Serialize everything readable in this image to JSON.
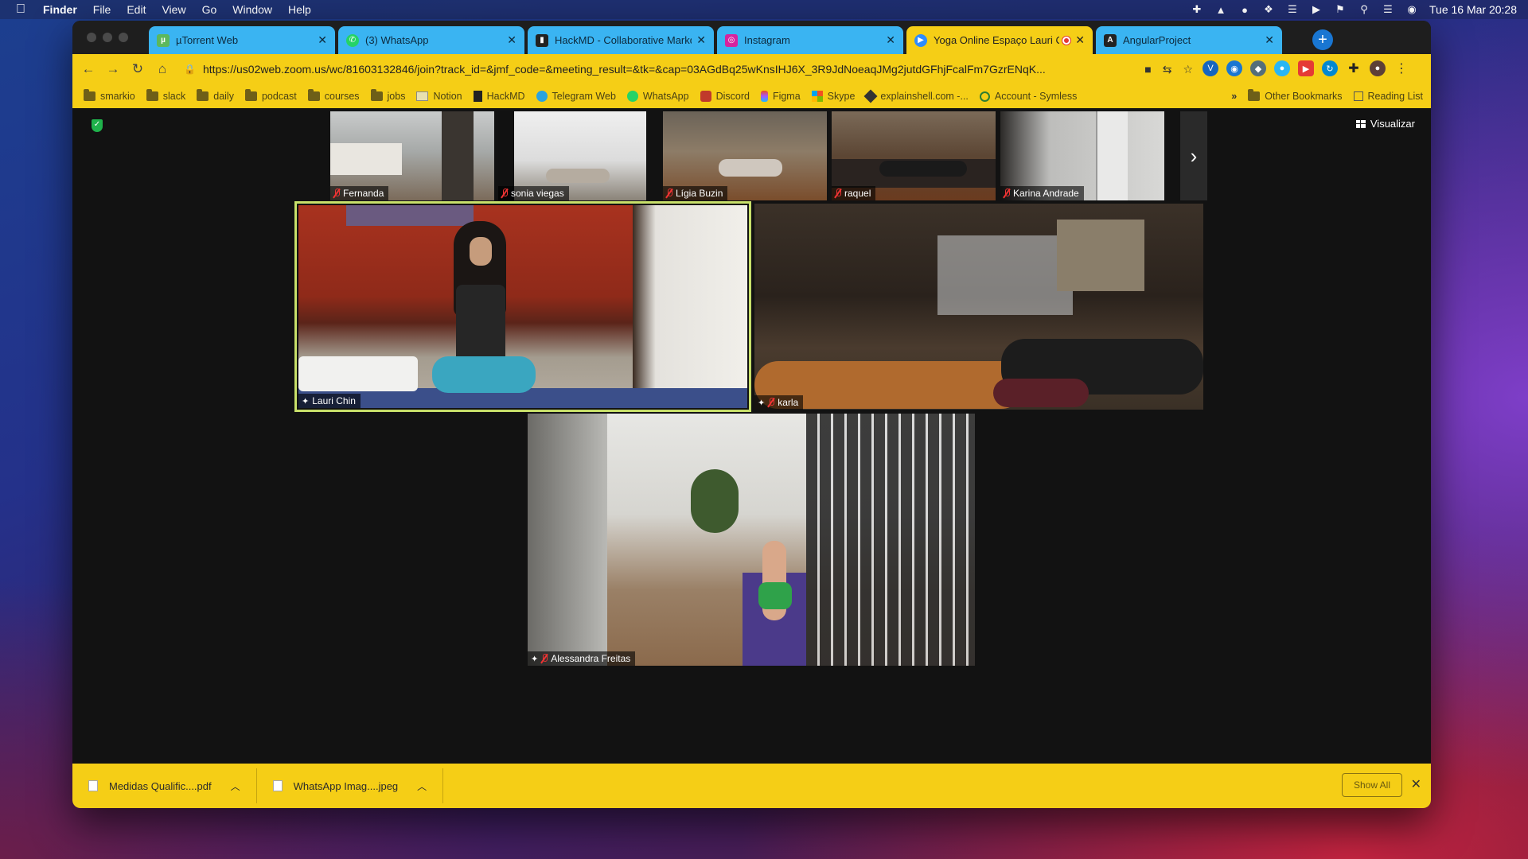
{
  "menubar": {
    "apple_icon": "apple-icon",
    "app_name": "Finder",
    "items": [
      "File",
      "Edit",
      "View",
      "Go",
      "Window",
      "Help"
    ],
    "clock": "Tue 16 Mar  20:28"
  },
  "tabs": [
    {
      "title": "µTorrent Web",
      "icon": "utorrent-icon",
      "color": "#3ab4f2"
    },
    {
      "title": "(3) WhatsApp",
      "icon": "whatsapp-icon",
      "color": "#3ab4f2"
    },
    {
      "title": "HackMD - Collaborative Markdown",
      "icon": "hackmd-icon",
      "color": "#3ab4f2"
    },
    {
      "title": "Instagram",
      "icon": "instagram-icon",
      "color": "#3ab4f2"
    },
    {
      "title": "Yoga Online Espaço Lauri Chin",
      "icon": "zoom-icon",
      "active": true,
      "recording": true
    },
    {
      "title": "AngularProject",
      "icon": "angular-icon",
      "color": "#3ab4f2"
    }
  ],
  "toolbar": {
    "url": "https://us02web.zoom.us/wc/81603132846/join?track_id=&jmf_code=&meeting_result=&tk=&cap=03AGdBq25wKnsIHJ6X_3R9JdNoeaqJMg2jutdGFhjFcalFm7GzrENqK..."
  },
  "bookmarks": [
    {
      "label": "smarkio",
      "type": "folder"
    },
    {
      "label": "slack",
      "type": "folder"
    },
    {
      "label": "daily",
      "type": "folder"
    },
    {
      "label": "podcast",
      "type": "folder"
    },
    {
      "label": "courses",
      "type": "folder"
    },
    {
      "label": "jobs",
      "type": "folder"
    },
    {
      "label": "Notion",
      "type": "link"
    },
    {
      "label": "HackMD",
      "type": "link"
    },
    {
      "label": "Telegram Web",
      "type": "link"
    },
    {
      "label": "WhatsApp",
      "type": "link"
    },
    {
      "label": "Discord",
      "type": "link"
    },
    {
      "label": "Figma",
      "type": "link"
    },
    {
      "label": "Skype",
      "type": "link"
    },
    {
      "label": "explainshell.com -...",
      "type": "link"
    },
    {
      "label": "Account - Symless",
      "type": "link"
    }
  ],
  "bookmarks_right": {
    "overflow": "»",
    "other": "Other Bookmarks",
    "reading_list": "Reading List"
  },
  "zoom": {
    "view_button": "Visualizar",
    "thumbnails": [
      {
        "name": "Fernanda"
      },
      {
        "name": "sonia viegas"
      },
      {
        "name": "Lígia Buzin"
      },
      {
        "name": "raquel"
      },
      {
        "name": "Karina Andrade"
      }
    ],
    "main_videos": [
      {
        "name": "Lauri Chin",
        "active_speaker": true
      },
      {
        "name": "karla"
      },
      {
        "name": "Alessandra Freitas"
      }
    ]
  },
  "downloads": {
    "items": [
      {
        "name": "Medidas Qualific....pdf"
      },
      {
        "name": "WhatsApp Imag....jpeg"
      }
    ],
    "show_all": "Show All"
  },
  "colors": {
    "chrome_theme": "#f5ce16",
    "inactive_tab": "#3ab4f2",
    "speaker_border": "#c8e06a"
  }
}
